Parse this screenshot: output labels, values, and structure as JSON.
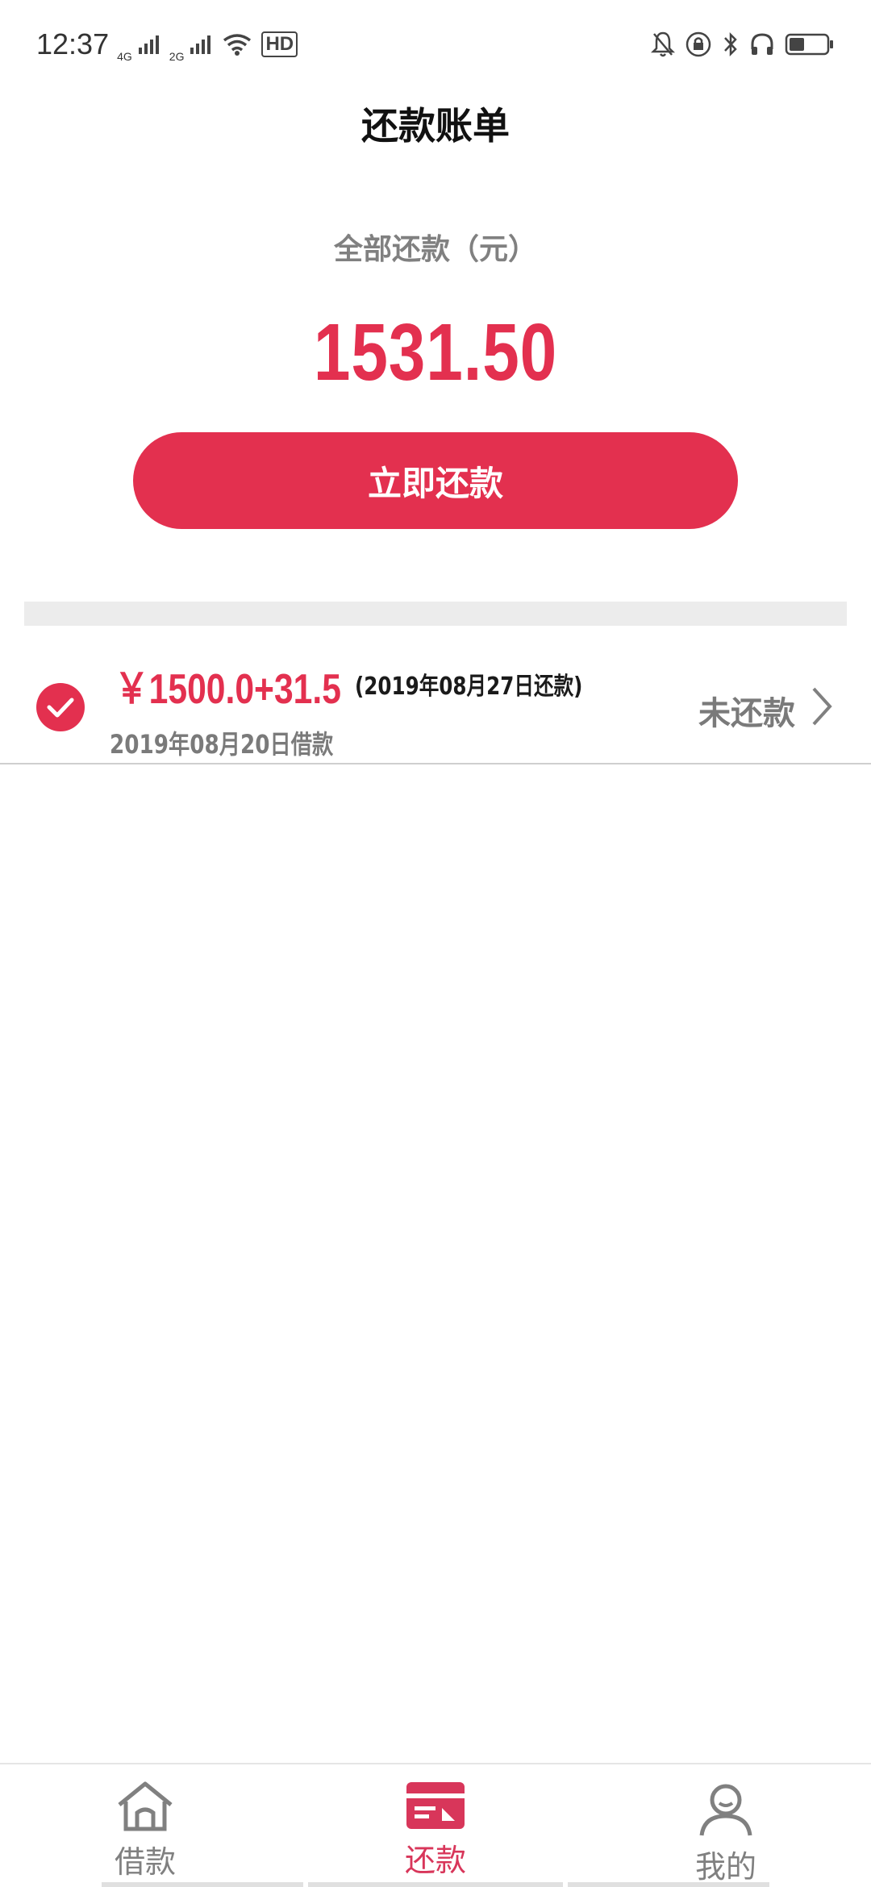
{
  "status_bar": {
    "time": "12:37",
    "network_1": "4G",
    "network_2": "2G",
    "hd_label": "HD"
  },
  "header": {
    "title": "还款账单"
  },
  "summary": {
    "label": "全部还款（元）",
    "amount": "1531.50",
    "button_label": "立即还款"
  },
  "bills": [
    {
      "amount": "￥1500.0+31.5",
      "due": "(2019年08月27日还款)",
      "borrow_date": "2019年08月20日借款",
      "status": "未还款",
      "selected": true
    }
  ],
  "bottom_nav": {
    "items": [
      {
        "label": "借款",
        "icon": "home-icon",
        "active": false
      },
      {
        "label": "还款",
        "icon": "bill-icon",
        "active": true
      },
      {
        "label": "我的",
        "icon": "user-icon",
        "active": false
      }
    ]
  },
  "colors": {
    "accent": "#e3304f",
    "nav_active": "#d8365a",
    "muted": "#808080"
  }
}
